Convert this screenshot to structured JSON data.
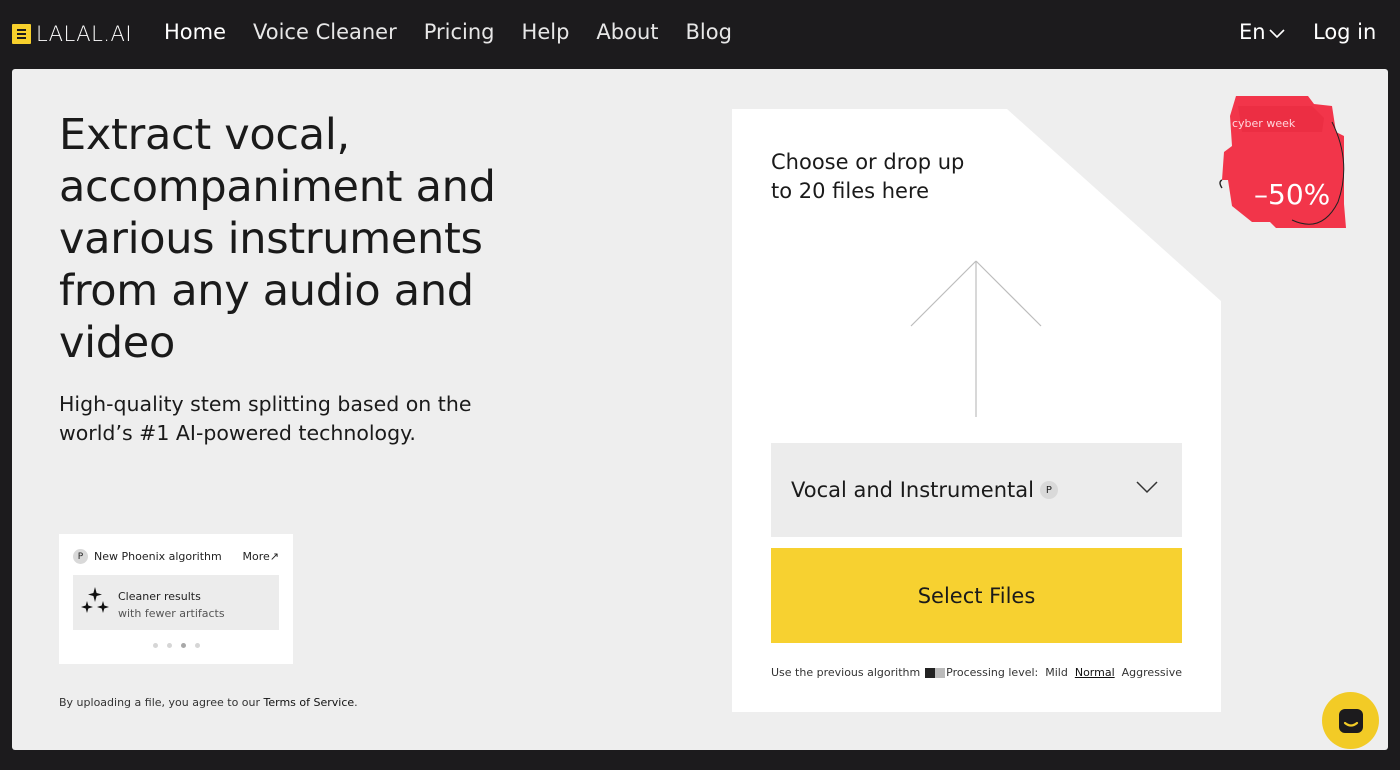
{
  "brand": {
    "name": "LALAL.AI",
    "accent": "#f7d02c"
  },
  "nav": {
    "items": [
      {
        "label": "Home"
      },
      {
        "label": "Voice Cleaner"
      },
      {
        "label": "Pricing"
      },
      {
        "label": "Help"
      },
      {
        "label": "About"
      },
      {
        "label": "Blog"
      }
    ],
    "active": "Home",
    "language": "En",
    "login": "Log in"
  },
  "hero": {
    "title": "Extract vocal, accompaniment and various instruments from any audio and video",
    "subtitle": "High-quality stem splitting based on the world’s #1 AI-powered technology."
  },
  "promo": {
    "badge": "P",
    "heading": "New Phoenix algorithm",
    "more": "More↗",
    "card_title": "Cleaner results",
    "card_text": "with fewer artifacts",
    "dots_total": 4,
    "dots_active": 3
  },
  "terms": {
    "prefix": "By uploading a file, you agree to our ",
    "link": "Terms of Service",
    "suffix": "."
  },
  "uploader": {
    "drop_text": "Choose or drop up to 20 files here",
    "algorithm_select": {
      "value": "Vocal and Instrumental",
      "badge": "P"
    },
    "select_button": "Select Files",
    "prev_algorithm_label": "Use the previous algorithm",
    "processing_label": "Processing level:",
    "levels": [
      "Mild",
      "Normal",
      "Aggressive"
    ],
    "selected_level": "Normal"
  },
  "sale_badge": {
    "tag": "cyber week",
    "discount": "–50%",
    "color": "#f2354a"
  },
  "icons": {
    "chevron": "chevron-down-icon",
    "upload": "upload-arrow-icon",
    "sparkles": "sparkles-icon",
    "chat": "chat-icon"
  }
}
